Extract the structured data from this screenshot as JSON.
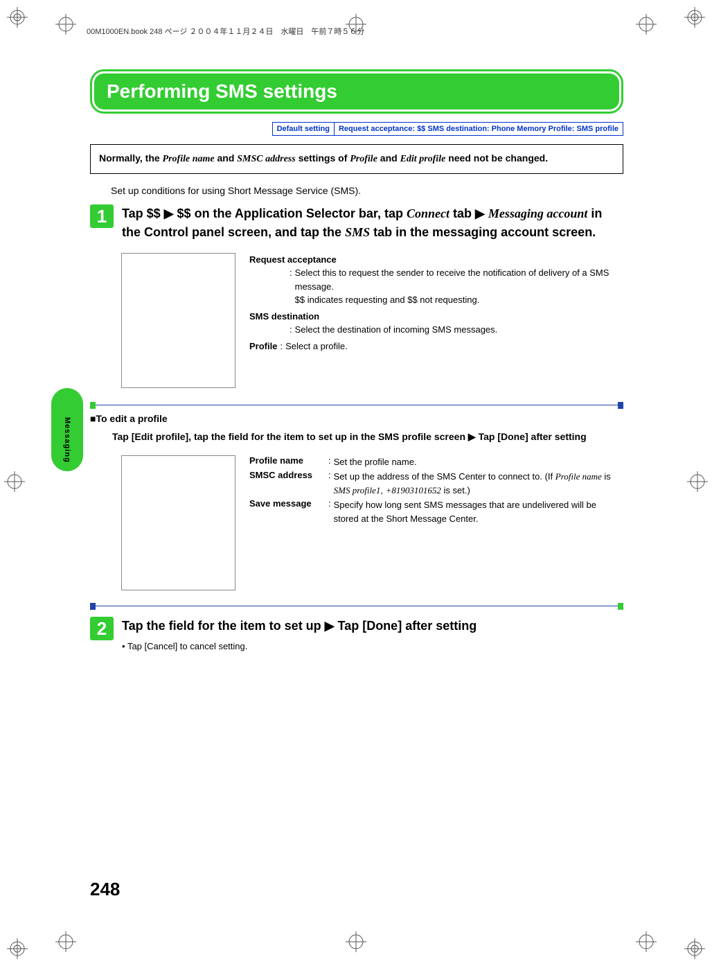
{
  "header": {
    "filename_line": "00M1000EN.book  248 ページ  ２００４年１１月２４日　水曜日　午前７時５６分"
  },
  "title": "Performing SMS settings",
  "default_setting": {
    "label": "Default setting",
    "values": "Request acceptance: $$    SMS destination: Phone Memory    Profile: SMS profile"
  },
  "note": {
    "pref": "Normally, the ",
    "i1": "Profile name",
    "mid1": " and ",
    "i2": "SMSC address",
    "mid2": " settings of ",
    "i3": "Profile",
    "mid3": " and ",
    "i4": "Edit profile",
    "suf": " need not be changed."
  },
  "intro": "Set up conditions for using Short Message Service (SMS).",
  "step1": {
    "num": "1",
    "p1": "Tap $$ ",
    "arrow": "▶",
    "p2": " $$ on the Application Selector bar, tap ",
    "i1": "Connect",
    "p3": " tab ",
    "i2": "Messaging account",
    "p4": " in the Control panel screen, and tap the ",
    "i3": "SMS",
    "p5": " tab in the messaging account screen."
  },
  "fields1": {
    "request_label": "Request acceptance",
    "request_colon": ":",
    "request_line1": "Select this to request the sender to receive the notification of delivery of a SMS message.",
    "request_line2": "$$ indicates requesting and $$ not requesting.",
    "smsdest_label": "SMS destination",
    "smsdest_desc": "Select the destination of incoming SMS messages.",
    "profile_label": "Profile",
    "profile_desc": "Select a profile."
  },
  "sub_heading": "To edit a profile",
  "sub_body": {
    "t1": "Tap [Edit profile], tap the field for the item to set up in the SMS profile screen ",
    "arrow": "▶",
    "t2": " Tap [Done] after setting"
  },
  "fields2": {
    "profile_name_label": "Profile name",
    "profile_name_desc": "Set the profile name.",
    "smsc_label": "SMSC address",
    "smsc_pref": "Set up the address of the SMS Center to connect to. (If ",
    "smsc_i1": "Profile name",
    "smsc_mid1": " is ",
    "smsc_i2": "SMS profile1",
    "smsc_mid2": ", ",
    "smsc_i3": "+81903101652",
    "smsc_suf": " is set.)",
    "save_label": "Save message",
    "save_desc": "Specify how long sent SMS messages that are undelivered will be stored at the Short Message Center."
  },
  "step2": {
    "num": "2",
    "t1": "Tap the field for the item to set up ",
    "arrow": "▶",
    "t2": " Tap [Done] after setting"
  },
  "cancel_note": "Tap [Cancel] to cancel setting.",
  "side_tab": "Messaging",
  "page_number": "248"
}
